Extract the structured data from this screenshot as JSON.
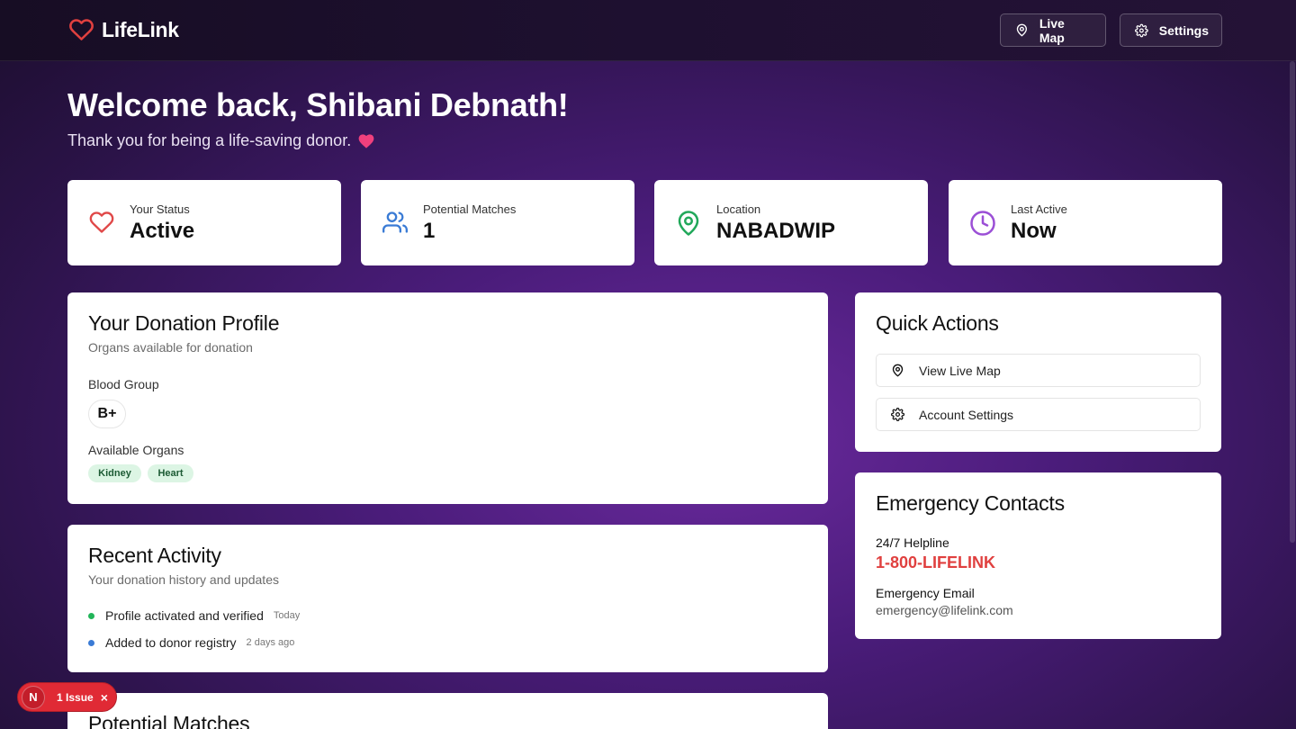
{
  "header": {
    "brand": "LifeLink",
    "live_map_label": "Live Map",
    "settings_label": "Settings"
  },
  "welcome": {
    "title": "Welcome back, Shibani Debnath!",
    "subtitle": "Thank you for being a life-saving donor."
  },
  "stats": [
    {
      "label": "Your Status",
      "value": "Active",
      "icon": "heart-icon",
      "color": "#e04848"
    },
    {
      "label": "Potential Matches",
      "value": "1",
      "icon": "users-icon",
      "color": "#3a7bd5"
    },
    {
      "label": "Location",
      "value": "NABADWIP",
      "icon": "map-pin-icon",
      "color": "#21a85a"
    },
    {
      "label": "Last Active",
      "value": "Now",
      "icon": "clock-icon",
      "color": "#9b4fd6"
    }
  ],
  "donation_profile": {
    "title": "Your Donation Profile",
    "subtitle": "Organs available for donation",
    "blood_group_label": "Blood Group",
    "blood_group": "B+",
    "organs_label": "Available Organs",
    "organs": [
      "Kidney",
      "Heart"
    ]
  },
  "recent_activity": {
    "title": "Recent Activity",
    "subtitle": "Your donation history and updates",
    "items": [
      {
        "text": "Profile activated and verified",
        "time": "Today",
        "color": "#22b559"
      },
      {
        "text": "Added to donor registry",
        "time": "2 days ago",
        "color": "#3a7bd5"
      }
    ]
  },
  "potential_matches": {
    "title": "Potential Matches"
  },
  "quick_actions": {
    "title": "Quick Actions",
    "view_map_label": "View Live Map",
    "account_settings_label": "Account Settings"
  },
  "emergency": {
    "title": "Emergency Contacts",
    "helpline_label": "24/7 Helpline",
    "helpline": "1-800-LIFELINK",
    "email_label": "Emergency Email",
    "email": "emergency@lifelink.com"
  },
  "issue_badge": {
    "letter": "N",
    "label": "1 Issue"
  }
}
